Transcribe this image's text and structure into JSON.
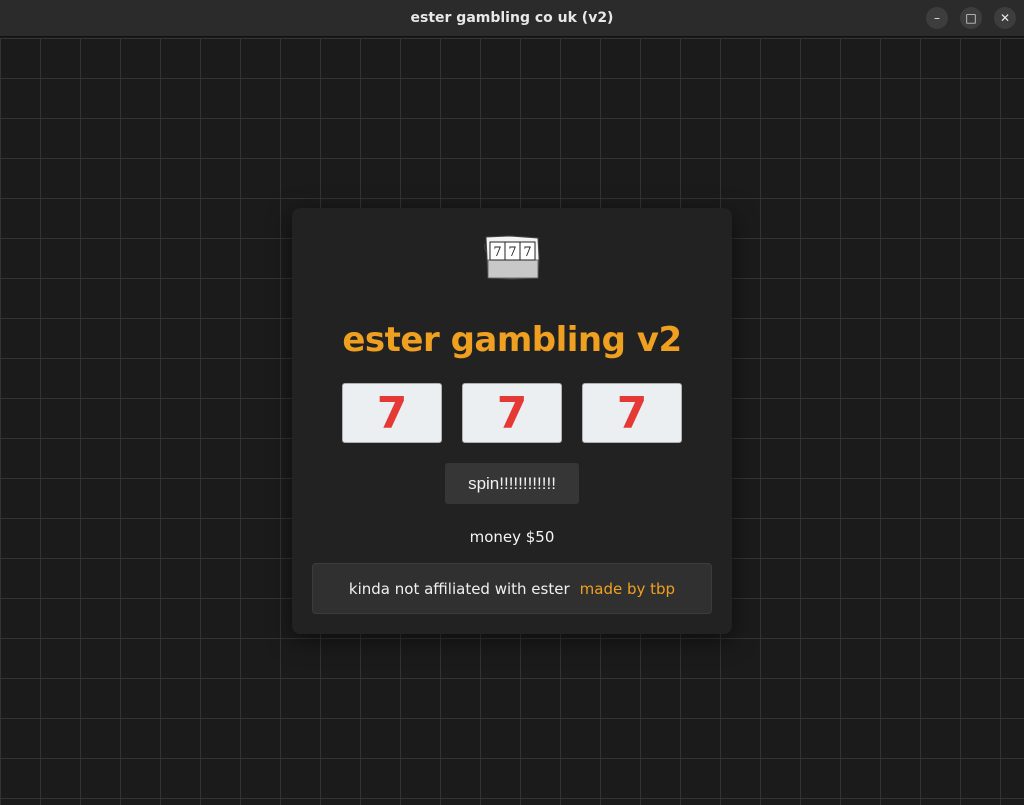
{
  "window": {
    "title": "ester gambling co uk (v2)",
    "minimize_glyph": "–",
    "maximize_glyph": "□",
    "close_glyph": "✕"
  },
  "logo": {
    "icon": "slot-machine-icon",
    "digits": [
      "7",
      "7",
      "7"
    ]
  },
  "app": {
    "title": "ester gambling v2",
    "accent_color": "#f0a020"
  },
  "reels": [
    "7",
    "7",
    "7"
  ],
  "reel_color": "#e53935",
  "spin_button": {
    "label": "spin!!!!!!!!!!!!"
  },
  "money": {
    "text": "money $50"
  },
  "footer": {
    "text": "kinda not affiliated with ester",
    "link": "made by tbp"
  }
}
